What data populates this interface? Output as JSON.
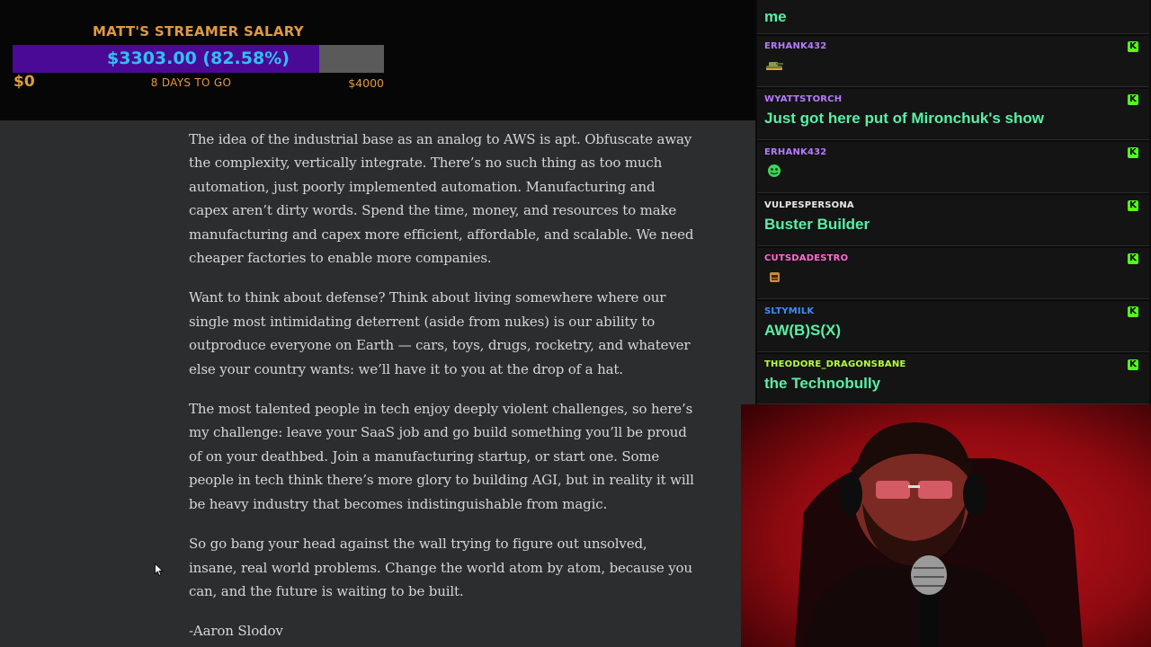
{
  "goal": {
    "title": "MATT'S STREAMER SALARY",
    "amount_label": "$3303.00 (82.58%)",
    "progress_fraction": 0.8258,
    "min_label": "$0",
    "days_label": "8 DAYS TO GO",
    "max_label": "$4000"
  },
  "article": {
    "paragraphs": [
      "The idea of the industrial base as an analog to AWS is apt. Obfuscate away the complexity, vertically integrate. There’s no such thing as too much automation, just poorly implemented automation. Manufacturing and capex aren’t dirty words. Spend the time, money, and resources to make manufacturing and capex more efficient, affordable, and scalable. We need cheaper factories to enable more companies.",
      "Want to think about defense? Think about living somewhere where our single most intimidating deterrent (aside from nukes) is our ability to outproduce everyone on Earth — cars, toys, drugs, rocketry, and whatever else your country wants: we’ll have it to you at the drop of a hat.",
      "The most talented people in tech enjoy deeply violent challenges, so here’s my challenge: leave your SaaS job and go build something you’ll be proud of on your deathbed. Join a manufacturing startup, or start one. Some people in tech think there’s more glory to building AGI, but in reality it will be heavy industry that becomes indistinguishable from magic.",
      "So go bang your head against the wall trying to figure out unsolved, insane, real world problems. Change the world atom by atom, because you can, and the future is waiting to be built.",
      "-Aaron Slodov"
    ]
  },
  "chat": {
    "messages": [
      {
        "user": "",
        "text": "me",
        "user_color": "#b57bff",
        "emote": ""
      },
      {
        "user": "ERHANK432",
        "text": "",
        "user_color": "#b57bff",
        "emote": "tank-emote"
      },
      {
        "user": "WYATTSTORCH",
        "text": "Just got here put of Mironchuk's show",
        "user_color": "#b57bff",
        "emote": ""
      },
      {
        "user": "ERHANK432",
        "text": "",
        "user_color": "#b57bff",
        "emote": "green-face-emote"
      },
      {
        "user": "VULPESPERSONA",
        "text": "Buster Builder",
        "user_color": "#e8e8e8",
        "emote": ""
      },
      {
        "user": "CUTSDADESTRO",
        "text": "",
        "user_color": "#ff6ad5",
        "emote": "box-emote"
      },
      {
        "user": "SLTYMILK",
        "text": "AW(B)S(X)",
        "user_color": "#3f8cff",
        "emote": ""
      },
      {
        "user": "THEODORE_DRAGONSBANE",
        "text": "the Technobully",
        "user_color": "#b8ff3a",
        "emote": ""
      }
    ],
    "badge_glyph": "K",
    "badge_color": "#53fc18",
    "message_color": "#58f0a6"
  },
  "webcam": {
    "description_icon": "streamer-webcam"
  }
}
